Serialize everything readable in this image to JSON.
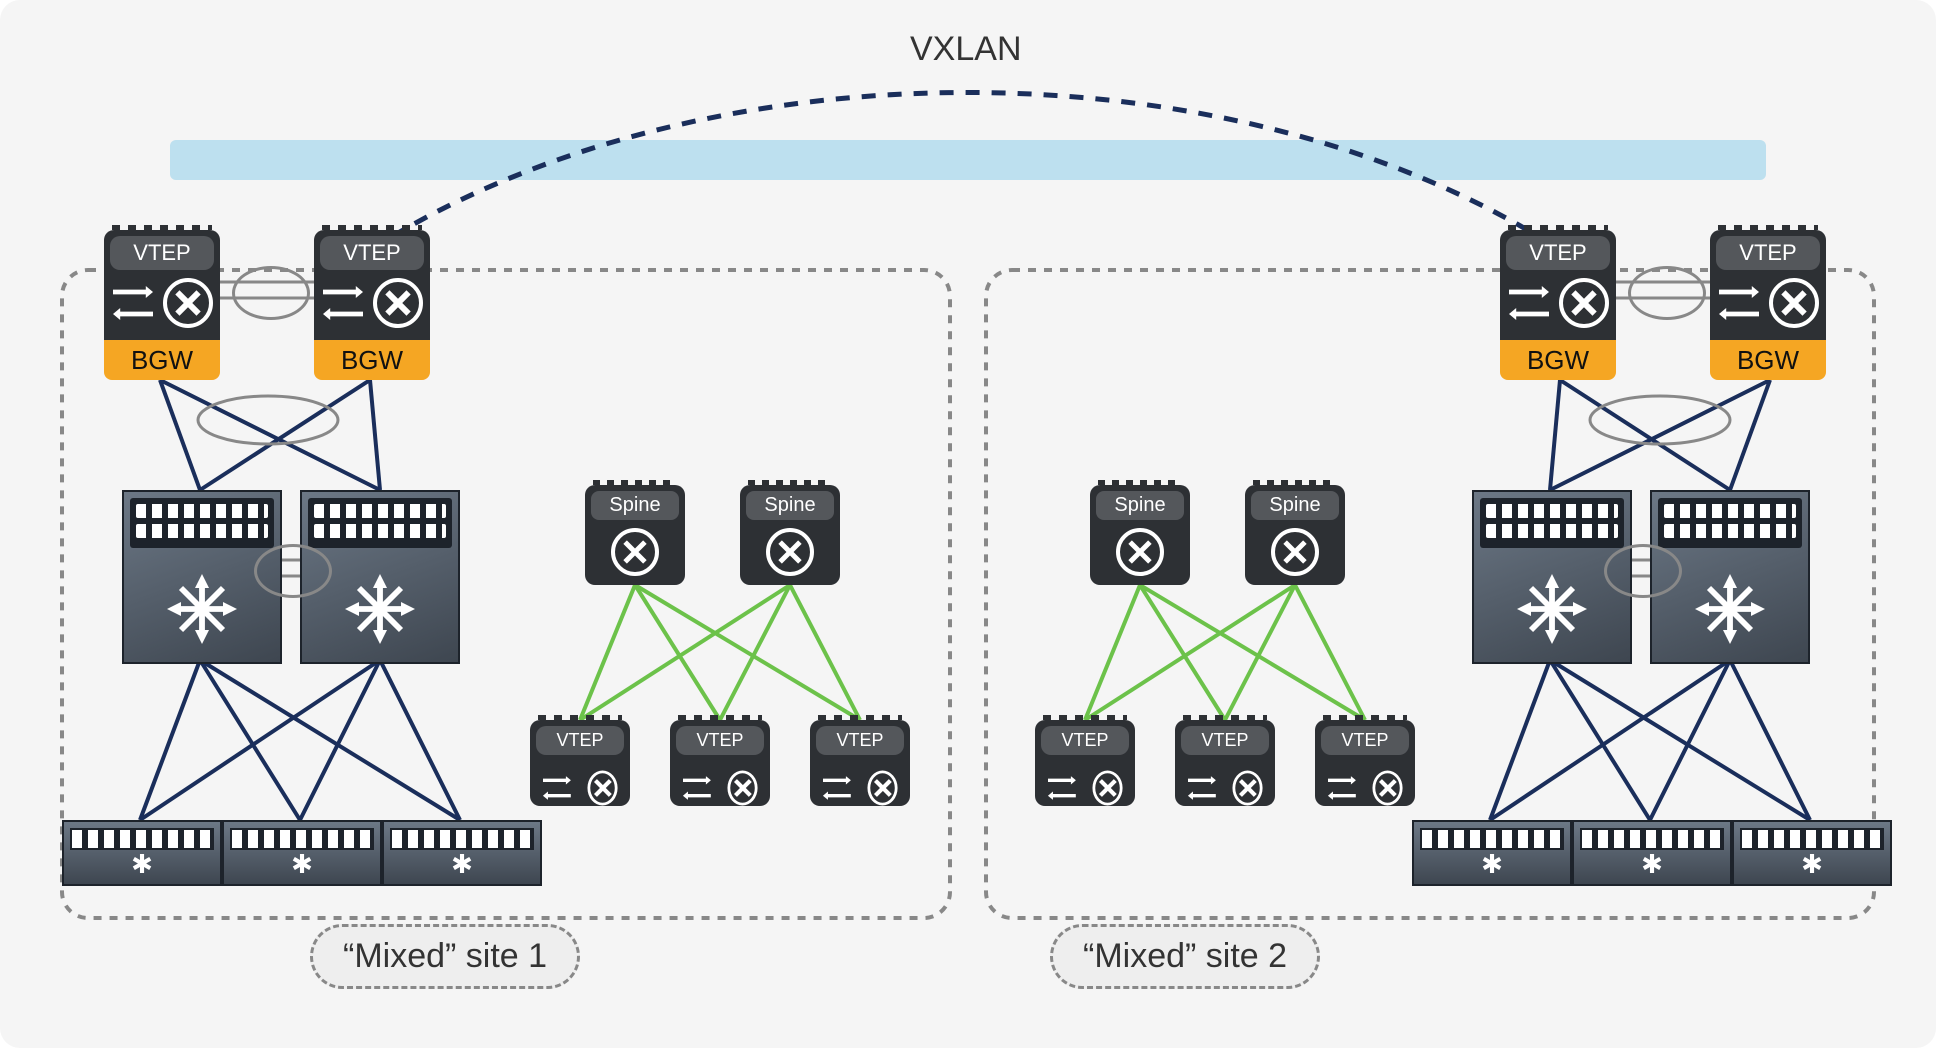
{
  "labels": {
    "vxlan": "VXLAN",
    "vtep": "VTEP",
    "bgw": "BGW",
    "spine": "Spine",
    "site1": "“Mixed” site 1",
    "site2": "“Mixed” site 2"
  },
  "colors": {
    "vxlan_dash": "#1a2e5b",
    "vxlan_band": "#bde0ef",
    "fabric_line": "#1a2e5b",
    "leaf_spine": "#6cc24a",
    "device_bg": "#2d3034",
    "bgw": "#f5a623",
    "dash": "#888888"
  },
  "topology": {
    "sites": [
      {
        "name": "Mixed site 1",
        "vpc_bgw_pair": 2,
        "modular_switch_pair": 2,
        "access_switches": 3,
        "vxlan_pod": {
          "spines": 2,
          "leaves_vtep": 3
        }
      },
      {
        "name": "Mixed site 2",
        "vpc_bgw_pair": 2,
        "modular_switch_pair": 2,
        "access_switches": 3,
        "vxlan_pod": {
          "spines": 2,
          "leaves_vtep": 3
        }
      }
    ],
    "intersite_link": "VXLAN"
  }
}
